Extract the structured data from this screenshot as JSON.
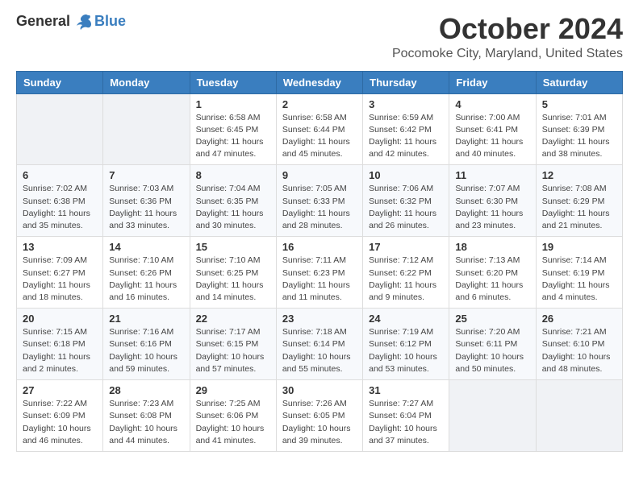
{
  "header": {
    "logo_general": "General",
    "logo_blue": "Blue",
    "month_title": "October 2024",
    "location": "Pocomoke City, Maryland, United States"
  },
  "weekdays": [
    "Sunday",
    "Monday",
    "Tuesday",
    "Wednesday",
    "Thursday",
    "Friday",
    "Saturday"
  ],
  "weeks": [
    [
      {
        "day": "",
        "info": ""
      },
      {
        "day": "",
        "info": ""
      },
      {
        "day": "1",
        "info": "Sunrise: 6:58 AM\nSunset: 6:45 PM\nDaylight: 11 hours and 47 minutes."
      },
      {
        "day": "2",
        "info": "Sunrise: 6:58 AM\nSunset: 6:44 PM\nDaylight: 11 hours and 45 minutes."
      },
      {
        "day": "3",
        "info": "Sunrise: 6:59 AM\nSunset: 6:42 PM\nDaylight: 11 hours and 42 minutes."
      },
      {
        "day": "4",
        "info": "Sunrise: 7:00 AM\nSunset: 6:41 PM\nDaylight: 11 hours and 40 minutes."
      },
      {
        "day": "5",
        "info": "Sunrise: 7:01 AM\nSunset: 6:39 PM\nDaylight: 11 hours and 38 minutes."
      }
    ],
    [
      {
        "day": "6",
        "info": "Sunrise: 7:02 AM\nSunset: 6:38 PM\nDaylight: 11 hours and 35 minutes."
      },
      {
        "day": "7",
        "info": "Sunrise: 7:03 AM\nSunset: 6:36 PM\nDaylight: 11 hours and 33 minutes."
      },
      {
        "day": "8",
        "info": "Sunrise: 7:04 AM\nSunset: 6:35 PM\nDaylight: 11 hours and 30 minutes."
      },
      {
        "day": "9",
        "info": "Sunrise: 7:05 AM\nSunset: 6:33 PM\nDaylight: 11 hours and 28 minutes."
      },
      {
        "day": "10",
        "info": "Sunrise: 7:06 AM\nSunset: 6:32 PM\nDaylight: 11 hours and 26 minutes."
      },
      {
        "day": "11",
        "info": "Sunrise: 7:07 AM\nSunset: 6:30 PM\nDaylight: 11 hours and 23 minutes."
      },
      {
        "day": "12",
        "info": "Sunrise: 7:08 AM\nSunset: 6:29 PM\nDaylight: 11 hours and 21 minutes."
      }
    ],
    [
      {
        "day": "13",
        "info": "Sunrise: 7:09 AM\nSunset: 6:27 PM\nDaylight: 11 hours and 18 minutes."
      },
      {
        "day": "14",
        "info": "Sunrise: 7:10 AM\nSunset: 6:26 PM\nDaylight: 11 hours and 16 minutes."
      },
      {
        "day": "15",
        "info": "Sunrise: 7:10 AM\nSunset: 6:25 PM\nDaylight: 11 hours and 14 minutes."
      },
      {
        "day": "16",
        "info": "Sunrise: 7:11 AM\nSunset: 6:23 PM\nDaylight: 11 hours and 11 minutes."
      },
      {
        "day": "17",
        "info": "Sunrise: 7:12 AM\nSunset: 6:22 PM\nDaylight: 11 hours and 9 minutes."
      },
      {
        "day": "18",
        "info": "Sunrise: 7:13 AM\nSunset: 6:20 PM\nDaylight: 11 hours and 6 minutes."
      },
      {
        "day": "19",
        "info": "Sunrise: 7:14 AM\nSunset: 6:19 PM\nDaylight: 11 hours and 4 minutes."
      }
    ],
    [
      {
        "day": "20",
        "info": "Sunrise: 7:15 AM\nSunset: 6:18 PM\nDaylight: 11 hours and 2 minutes."
      },
      {
        "day": "21",
        "info": "Sunrise: 7:16 AM\nSunset: 6:16 PM\nDaylight: 10 hours and 59 minutes."
      },
      {
        "day": "22",
        "info": "Sunrise: 7:17 AM\nSunset: 6:15 PM\nDaylight: 10 hours and 57 minutes."
      },
      {
        "day": "23",
        "info": "Sunrise: 7:18 AM\nSunset: 6:14 PM\nDaylight: 10 hours and 55 minutes."
      },
      {
        "day": "24",
        "info": "Sunrise: 7:19 AM\nSunset: 6:12 PM\nDaylight: 10 hours and 53 minutes."
      },
      {
        "day": "25",
        "info": "Sunrise: 7:20 AM\nSunset: 6:11 PM\nDaylight: 10 hours and 50 minutes."
      },
      {
        "day": "26",
        "info": "Sunrise: 7:21 AM\nSunset: 6:10 PM\nDaylight: 10 hours and 48 minutes."
      }
    ],
    [
      {
        "day": "27",
        "info": "Sunrise: 7:22 AM\nSunset: 6:09 PM\nDaylight: 10 hours and 46 minutes."
      },
      {
        "day": "28",
        "info": "Sunrise: 7:23 AM\nSunset: 6:08 PM\nDaylight: 10 hours and 44 minutes."
      },
      {
        "day": "29",
        "info": "Sunrise: 7:25 AM\nSunset: 6:06 PM\nDaylight: 10 hours and 41 minutes."
      },
      {
        "day": "30",
        "info": "Sunrise: 7:26 AM\nSunset: 6:05 PM\nDaylight: 10 hours and 39 minutes."
      },
      {
        "day": "31",
        "info": "Sunrise: 7:27 AM\nSunset: 6:04 PM\nDaylight: 10 hours and 37 minutes."
      },
      {
        "day": "",
        "info": ""
      },
      {
        "day": "",
        "info": ""
      }
    ]
  ]
}
